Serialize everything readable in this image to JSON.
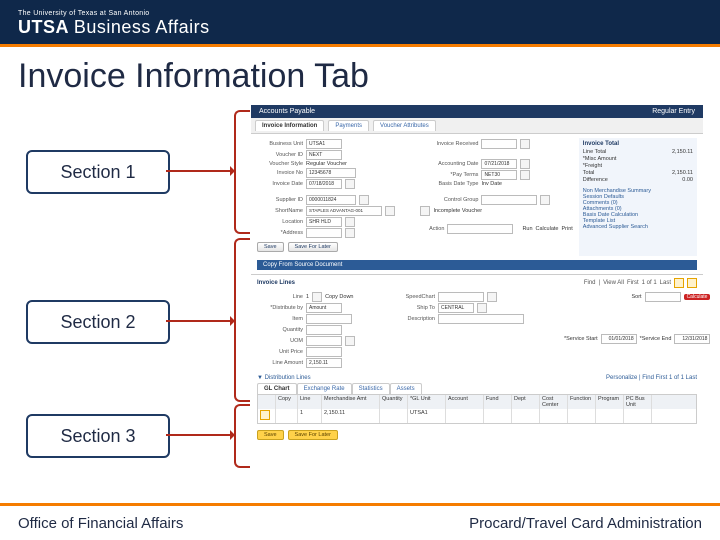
{
  "header": {
    "university": "The University of Texas at San Antonio",
    "brand_bold": "UTSA",
    "brand_thin": "Business Affairs"
  },
  "title": "Invoice Information Tab",
  "sections": {
    "s1": "Section 1",
    "s2": "Section 2",
    "s3": "Section 3"
  },
  "app": {
    "topbar_left": "Accounts Payable",
    "topbar_right": "Regular Entry",
    "tabs": {
      "t1": "Invoice Information",
      "t2": "Payments",
      "t3": "Voucher Attributes"
    },
    "summary_header": "Invoice Total",
    "summary": {
      "line_total_lbl": "Line Total",
      "line_total_val": "2,150.11",
      "misc_lbl": "*Misc Amount",
      "misc_val": "",
      "freight_lbl": "*Freight",
      "freight_val": "",
      "total_lbl": "Total",
      "total_val": "2,150.11",
      "diff_lbl": "Difference",
      "diff_val": "0.00"
    },
    "rightlinks": {
      "a": "Non Merchandise Summary",
      "b": "Session Defaults",
      "c": "Comments (0)",
      "d": "Attachments (0)",
      "e": "Basis Date Calculation",
      "f": "Template List",
      "g": "Advanced Supplier Search"
    },
    "fields": {
      "bu_lbl": "Business Unit",
      "bu_val": "UTSA1",
      "vid_lbl": "Voucher ID",
      "vid_val": "NEXT",
      "style_lbl": "Voucher Style",
      "style_val": "Regular Voucher",
      "invn_lbl": "Invoice No",
      "invn_val": "12345678",
      "invd_lbl": "Invoice Date",
      "invd_val": "07/18/2018",
      "supp_lbl": "Supplier ID",
      "supp_val": "0000011824",
      "short_lbl": "ShortName",
      "short_val": "STAPLES ADVANTAG-001",
      "loc_lbl": "Location",
      "loc_val": "SHR HLD",
      "addr_lbl": "*Address",
      "invr_lbl": "Invoice Received",
      "acct_lbl": "Accounting Date",
      "acct_val": "07/21/2018",
      "pay_lbl": "*Pay Terms",
      "pay_val": "NET30",
      "basis_lbl": "Basis Date Type",
      "basis_val": "Inv Date",
      "ctrl_lbl": "Control Group",
      "intercomp_lbl": "Incomplete Voucher",
      "action_lbl": "Action"
    },
    "buttons": {
      "save": "Save",
      "save_later": "Save For Later",
      "run": "Run",
      "calc": "Calculate",
      "print": "Print"
    },
    "copy_header": "Copy From Source Document",
    "lines": {
      "title": "Invoice Lines",
      "find_lbl": "Find",
      "view_all_lbl": "View All",
      "first_lbl": "First",
      "count": "1 of 1",
      "last_lbl": "Last",
      "line_lbl": "Line",
      "line_val": "1",
      "copy_down": "Copy Down",
      "speed_lbl": "SpeedChart",
      "ship_lbl": "Ship To",
      "ship_val": "CENTRAL",
      "dist_lbl": "*Distribute by",
      "dist_val": "Amount",
      "item_lbl": "Item",
      "desc_lbl": "Description",
      "qty_lbl": "Quantity",
      "uom_lbl": "UOM",
      "price_lbl": "Unit Price",
      "amt_lbl": "Line Amount",
      "amt_val": "2,150.11",
      "svc_start_lbl": "*Service Start",
      "svc_start_val": "01/01/2018",
      "svc_end_lbl": "*Service End",
      "svc_end_val": "12/31/2018",
      "sort_lbl": "Sort",
      "badge": "Calculate"
    },
    "dist": {
      "title": "▼ Distribution Lines",
      "pers_lbl": "Personalize | Find",
      "first_lbl": "First",
      "count": "1 of 1",
      "last_lbl": "Last",
      "subtab1": "GL Chart",
      "subtab2": "Exchange Rate",
      "subtab3": "Statistics",
      "subtab4": "Assets",
      "th": {
        "a": "",
        "b": "Copy",
        "c": "Line",
        "d": "Merchandise Amt",
        "e": "Quantity",
        "f": "*GL Unit",
        "g": "Account",
        "h": "Fund",
        "i": "Dept",
        "j": "Cost Center",
        "k": "Function",
        "l": "Program",
        "m": "PC Bus Unit"
      },
      "tr": {
        "b": "",
        "c": "1",
        "d": "2,150.11",
        "e": "",
        "f": "UTSA1",
        "g": "",
        "h": "",
        "i": "",
        "j": "",
        "k": "",
        "l": "",
        "m": ""
      },
      "save": "Save",
      "save_later": "Save For Later"
    }
  },
  "footer": {
    "left": "Office of Financial Affairs",
    "right": "Procard/Travel Card Administration"
  }
}
